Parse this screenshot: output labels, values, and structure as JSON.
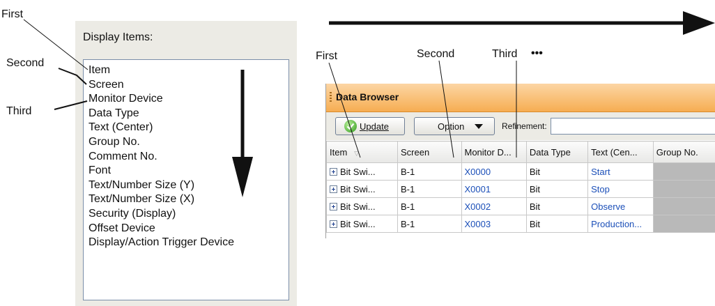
{
  "left_callouts": {
    "first": "First",
    "second": "Second",
    "third": "Third"
  },
  "display_items": {
    "title": "Display Items:",
    "items": [
      "Item",
      "Screen",
      "Monitor Device",
      "Data Type",
      "Text (Center)",
      "Group No.",
      "Comment No.",
      "Font",
      "Text/Number Size (Y)",
      "Text/Number Size (X)",
      "Security (Display)",
      "Offset Device",
      "Display/Action Trigger Device"
    ]
  },
  "right_callouts": {
    "first": "First",
    "second": "Second",
    "third": "Third",
    "more": "•••"
  },
  "data_browser": {
    "title": "Data Browser",
    "update_label": "Update",
    "option_label": "Option",
    "refinement_label": "Refinement:",
    "refinement_value": "",
    "columns": [
      "Item",
      "Screen",
      "Monitor D...",
      "Data Type",
      "Text (Cen...",
      "Group No."
    ],
    "rows": [
      {
        "item": "Bit Swi...",
        "screen": "B-1",
        "device": "X0000",
        "type": "Bit",
        "text": "Start"
      },
      {
        "item": "Bit Swi...",
        "screen": "B-1",
        "device": "X0001",
        "type": "Bit",
        "text": "Stop"
      },
      {
        "item": "Bit Swi...",
        "screen": "B-1",
        "device": "X0002",
        "type": "Bit",
        "text": "Observe"
      },
      {
        "item": "Bit Swi...",
        "screen": "B-1",
        "device": "X0003",
        "type": "Bit",
        "text": "Production..."
      }
    ]
  },
  "colors": {
    "titlebar": "#f6ad52",
    "panel": "#ecebe5",
    "link_blue": "#1b4fb8"
  }
}
